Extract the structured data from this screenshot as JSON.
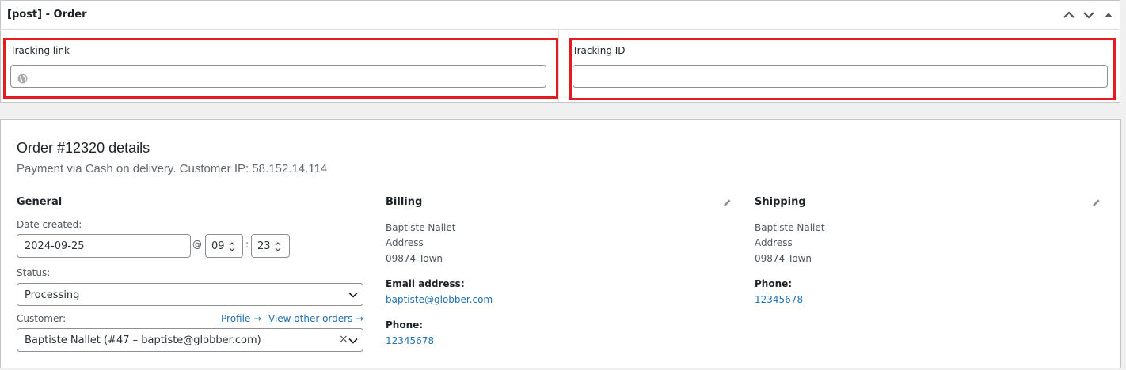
{
  "metabox": {
    "title": "[post] - Order",
    "tracking_link": {
      "label": "Tracking link",
      "value": ""
    },
    "tracking_id": {
      "label": "Tracking ID",
      "value": ""
    },
    "accent": "#e31b23"
  },
  "order": {
    "title": "Order #12320 details",
    "subtitle": "Payment via Cash on delivery. Customer IP: 58.152.14.114",
    "general": {
      "heading": "General",
      "date_label": "Date created:",
      "date_value": "2024-09-25",
      "at_symbol": "@",
      "hour_value": "09",
      "time_colon": ":",
      "minute_value": "23",
      "status_label": "Status:",
      "status_value": "Processing",
      "customer_label": "Customer:",
      "profile_link": "Profile →",
      "view_orders_link": "View other orders →",
      "customer_value": "Baptiste Nallet (#47 – baptiste@globber.com)",
      "clear_symbol": "×"
    },
    "billing": {
      "heading": "Billing",
      "name": "Baptiste Nallet",
      "address": "Address",
      "town": "09874 Town",
      "email_label": "Email address:",
      "email": "baptiste@globber.com",
      "phone_label": "Phone:",
      "phone": "12345678"
    },
    "shipping": {
      "heading": "Shipping",
      "name": "Baptiste Nallet",
      "address": "Address",
      "town": "09874 Town",
      "phone_label": "Phone:",
      "phone": "12345678"
    },
    "link_color": "#2271b1"
  }
}
